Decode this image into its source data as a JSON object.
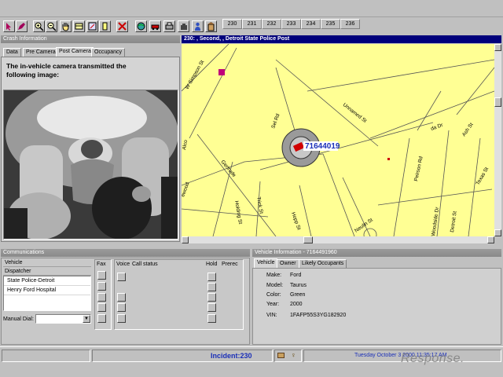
{
  "toolbar": {
    "icons": [
      "select-arrow-icon",
      "draw-tool-icon",
      "zoom-in-icon",
      "zoom-out-icon",
      "pan-hand-icon",
      "layers-icon",
      "measure-icon",
      "info-icon",
      "clear-icon",
      "globe-icon",
      "vehicle-icon",
      "print-icon",
      "hand-icon",
      "user-icon",
      "building-icon"
    ],
    "incident_tabs": [
      "230",
      "231",
      "232",
      "233",
      "234",
      "235",
      "236"
    ]
  },
  "crash_panel": {
    "title": "Crash Information",
    "tabs": [
      "Data",
      "Pre Camera",
      "Post Camera",
      "Occupancy"
    ],
    "active_tab": "Post Camera",
    "message": "The in-vehicle camera transmitted the following image:"
  },
  "map_panel": {
    "title": "230: , Second, , Detroit State Police Post",
    "vehicle_label": "71644019",
    "streets": [
      "W Simpson St",
      "Unnamed St",
      "da Dr",
      "Ash St",
      "Peirson Rd",
      "Texas St",
      "Gertrude",
      "Holding St",
      "Trick St",
      "Hopp St",
      "Neulin St",
      "Detroit St",
      "Woodside Dr",
      "Alco",
      "Sel Rd",
      "ewood"
    ]
  },
  "comm_panel": {
    "title": "Communications",
    "vehicle_label": "Vehicle",
    "dispatcher_label": "Dispatcher",
    "list": [
      "State Police-Detroit",
      "Henry Ford Hospital"
    ],
    "fax_label": "Fax",
    "voice_label": "Voice",
    "call_status_label": "Call status",
    "hold_label": "Hold",
    "prerec_label": "Prerec",
    "manual_dial_label": "Manual Dial:",
    "manual_dial_value": ""
  },
  "vehicle_panel": {
    "title": "Vehicle Information - 7164491960",
    "tabs": [
      "Vehicle",
      "Owner",
      "Likely Occupants"
    ],
    "active_tab": "Vehicle",
    "fields": [
      {
        "label": "Make:",
        "value": "Ford"
      },
      {
        "label": "Model:",
        "value": "Taurus"
      },
      {
        "label": "Color:",
        "value": "Green"
      },
      {
        "label": "Year:",
        "value": "2000"
      },
      {
        "label": "VIN:",
        "value": "1FAFP55S3YG182920"
      }
    ]
  },
  "statusbar": {
    "incident": "Incident:230",
    "datetime": "Tuesday October 3 2000 11:35:17 AM"
  },
  "watermark": "Response.",
  "colors": {
    "map_bg": "#ffff94",
    "title_blue": "#00007b",
    "incident_text": "#1a2fb8",
    "vehicle_red": "#d10000"
  }
}
